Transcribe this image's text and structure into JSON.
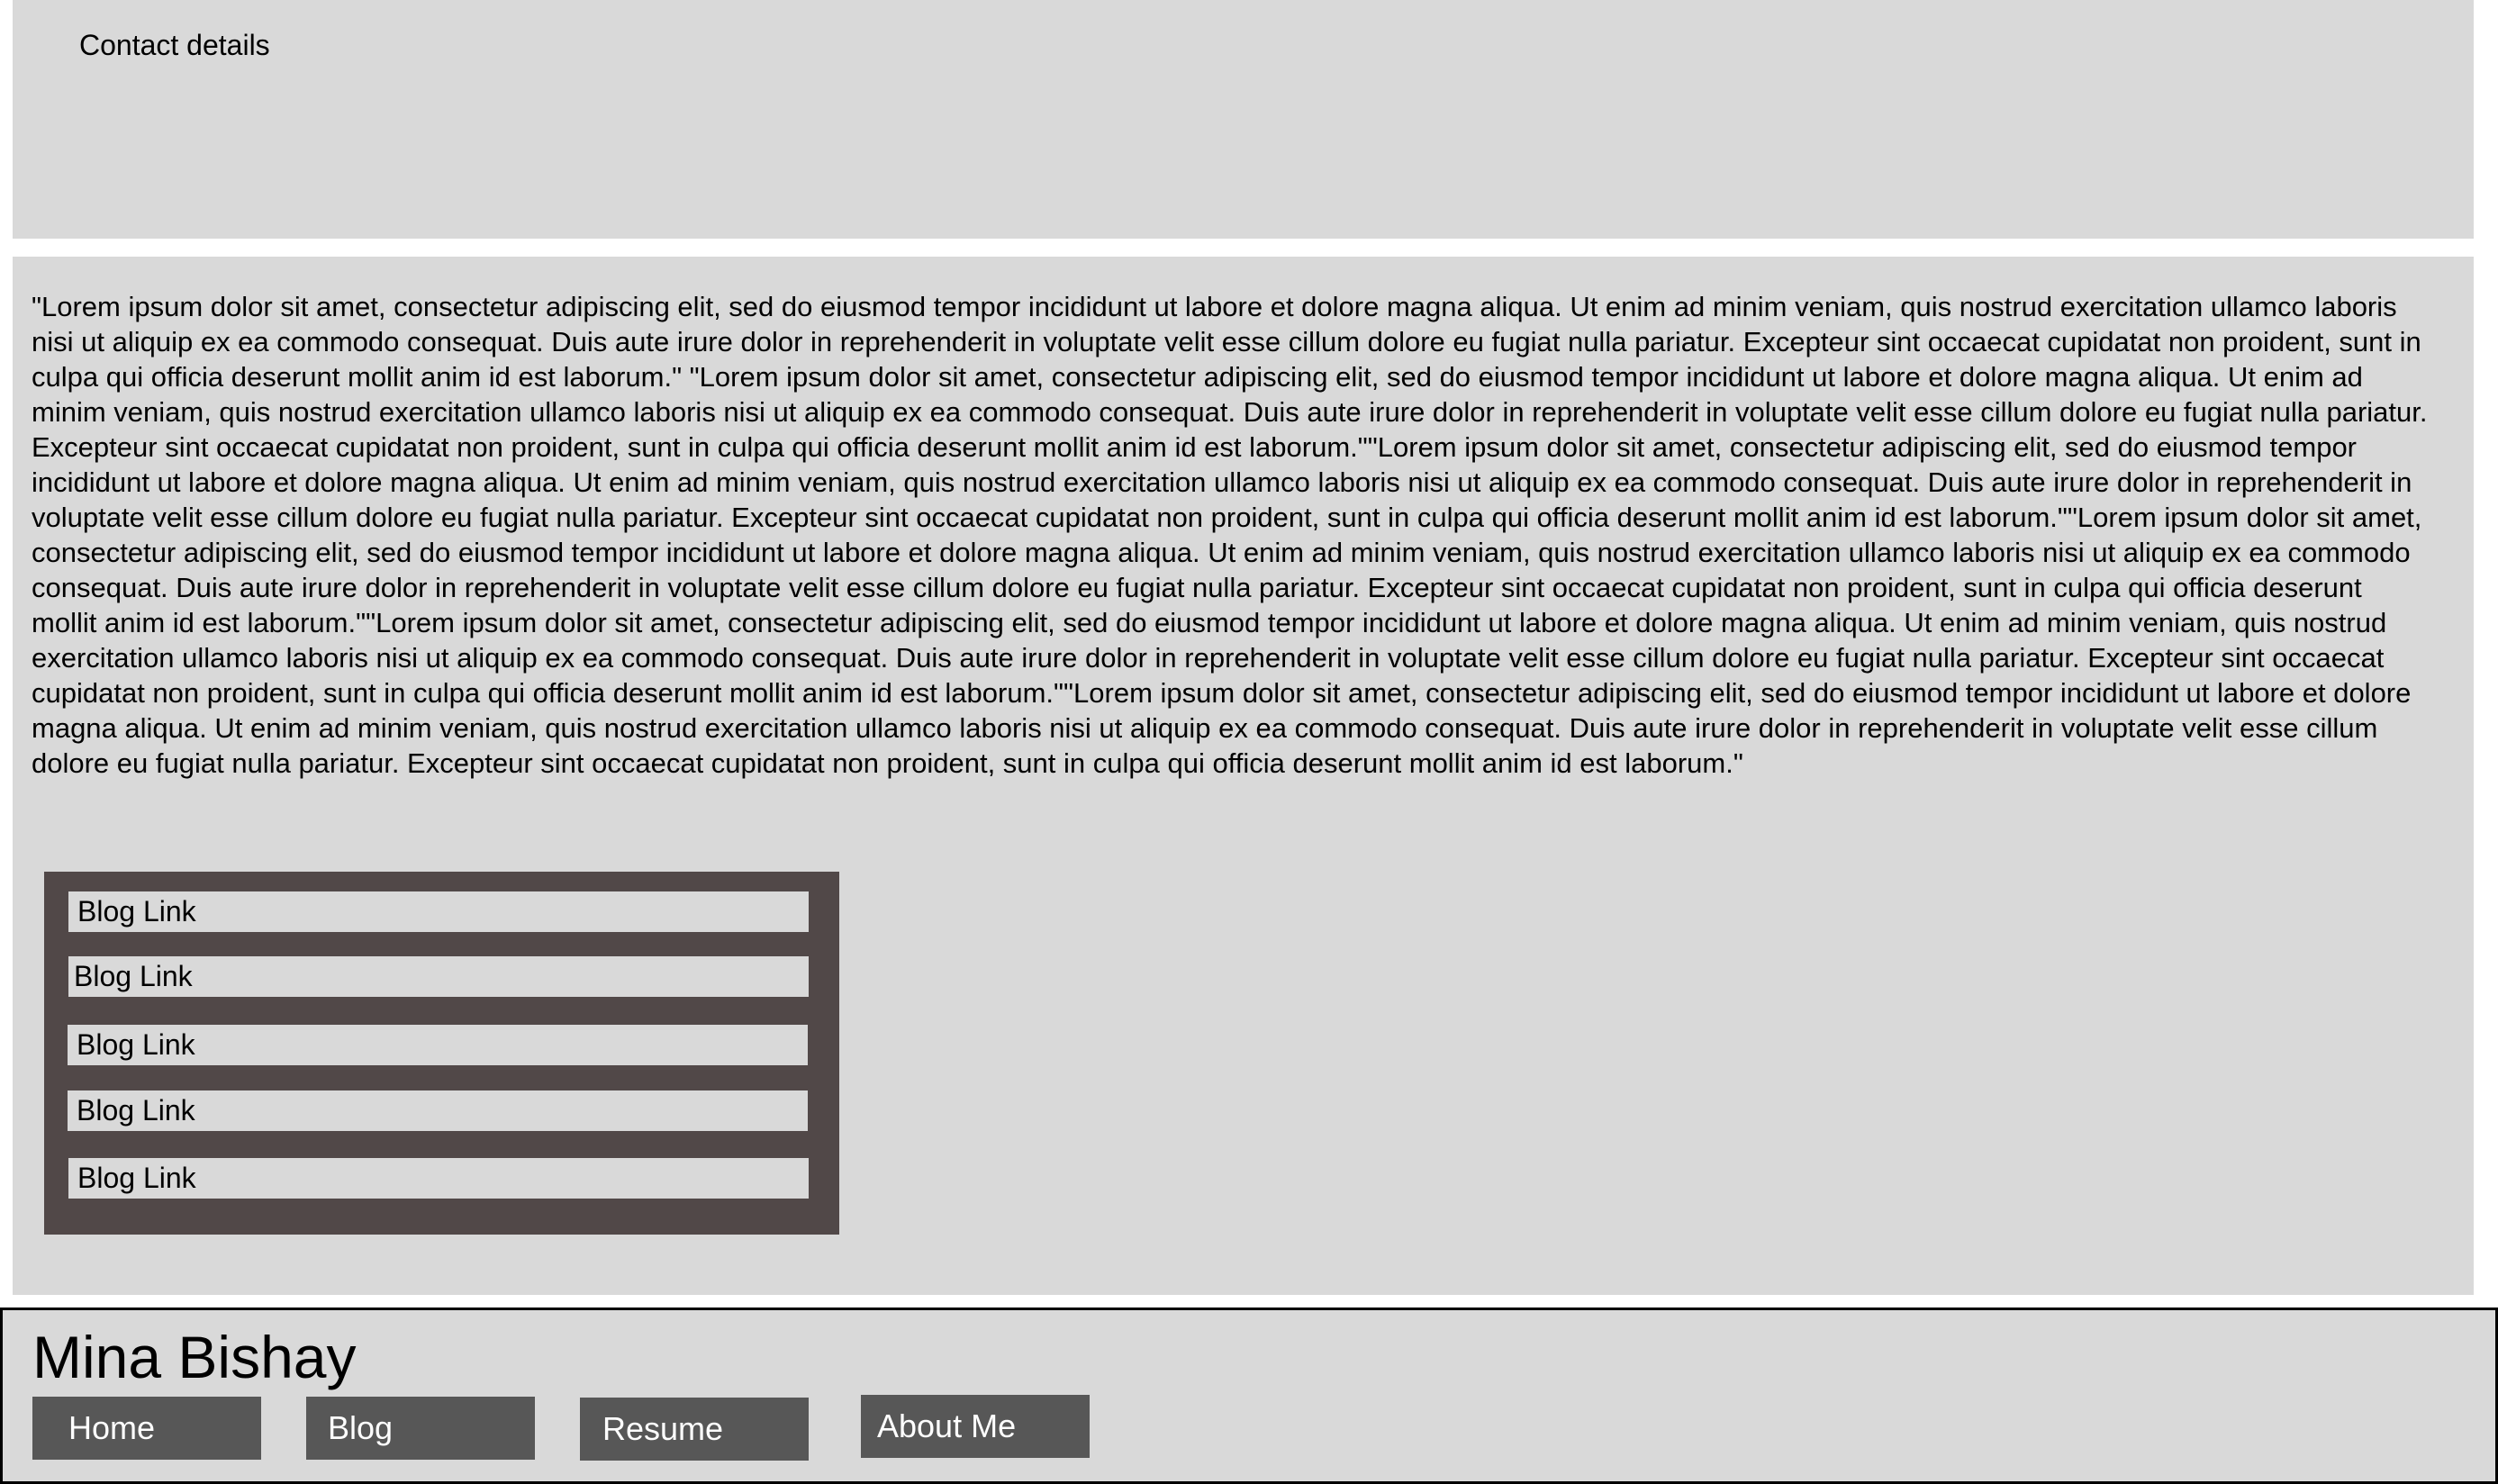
{
  "contact": {
    "title": "Contact details"
  },
  "main": {
    "body_text": "\"Lorem ipsum dolor sit amet, consectetur adipiscing elit, sed do eiusmod tempor incididunt ut labore et dolore magna aliqua. Ut enim ad minim veniam, quis nostrud exercitation ullamco laboris nisi ut aliquip ex ea commodo consequat. Duis aute irure dolor in reprehenderit in voluptate velit esse cillum dolore eu fugiat nulla pariatur. Excepteur sint occaecat cupidatat non proident, sunt in culpa qui officia deserunt mollit anim id est laborum.\" \"Lorem ipsum dolor sit amet, consectetur adipiscing elit, sed do eiusmod tempor incididunt ut labore et dolore magna aliqua. Ut enim ad minim veniam, quis nostrud exercitation ullamco laboris nisi ut aliquip ex ea commodo consequat. Duis aute irure dolor in reprehenderit in voluptate velit esse cillum dolore eu fugiat nulla pariatur. Excepteur sint occaecat cupidatat non proident, sunt in culpa qui officia deserunt mollit anim id est laborum.\"\"Lorem ipsum dolor sit amet, consectetur adipiscing elit, sed do eiusmod tempor incididunt ut labore et dolore magna aliqua. Ut enim ad minim veniam, quis nostrud exercitation ullamco laboris nisi ut aliquip ex ea commodo consequat. Duis aute irure dolor in reprehenderit in voluptate velit esse cillum dolore eu fugiat nulla pariatur. Excepteur sint occaecat cupidatat non proident, sunt in culpa qui officia deserunt mollit anim id est laborum.\"\"Lorem ipsum dolor sit amet, consectetur adipiscing elit, sed do eiusmod tempor incididunt ut labore et dolore magna aliqua. Ut enim ad minim veniam, quis nostrud exercitation ullamco laboris nisi ut aliquip ex ea commodo consequat. Duis aute irure dolor in reprehenderit in voluptate velit esse cillum dolore eu fugiat nulla pariatur. Excepteur sint occaecat cupidatat non proident, sunt in culpa qui officia deserunt mollit anim id est laborum.\"\"Lorem ipsum dolor sit amet, consectetur adipiscing elit, sed do eiusmod tempor incididunt ut labore et dolore magna aliqua. Ut enim ad minim veniam, quis nostrud exercitation ullamco laboris nisi ut aliquip ex ea commodo consequat. Duis aute irure dolor in reprehenderit in voluptate velit esse cillum dolore eu fugiat nulla pariatur. Excepteur sint occaecat cupidatat non proident, sunt in culpa qui officia deserunt mollit anim id est laborum.\"\"Lorem ipsum dolor sit amet, consectetur adipiscing elit, sed do eiusmod tempor incididunt ut labore et dolore magna aliqua. Ut enim ad minim veniam, quis nostrud exercitation ullamco laboris nisi ut aliquip ex ea commodo consequat. Duis aute irure dolor in reprehenderit in voluptate velit esse cillum dolore eu fugiat nulla pariatur. Excepteur sint occaecat cupidatat non proident, sunt in culpa qui officia deserunt mollit anim id est laborum.\""
  },
  "blog_links": [
    {
      "label": "Blog Link"
    },
    {
      "label": "Blog Link"
    },
    {
      "label": "Blog Link"
    },
    {
      "label": "Blog Link"
    },
    {
      "label": "Blog Link"
    }
  ],
  "footer": {
    "site_name": "Mina Bishay",
    "nav": [
      {
        "label": "Home"
      },
      {
        "label": "Blog"
      },
      {
        "label": "Resume"
      },
      {
        "label": "About Me"
      }
    ]
  },
  "colors": {
    "panel_background": "#d9d9d9",
    "blog_box_background": "#514848",
    "nav_button_background": "#575757",
    "nav_button_text": "#ffffff"
  }
}
